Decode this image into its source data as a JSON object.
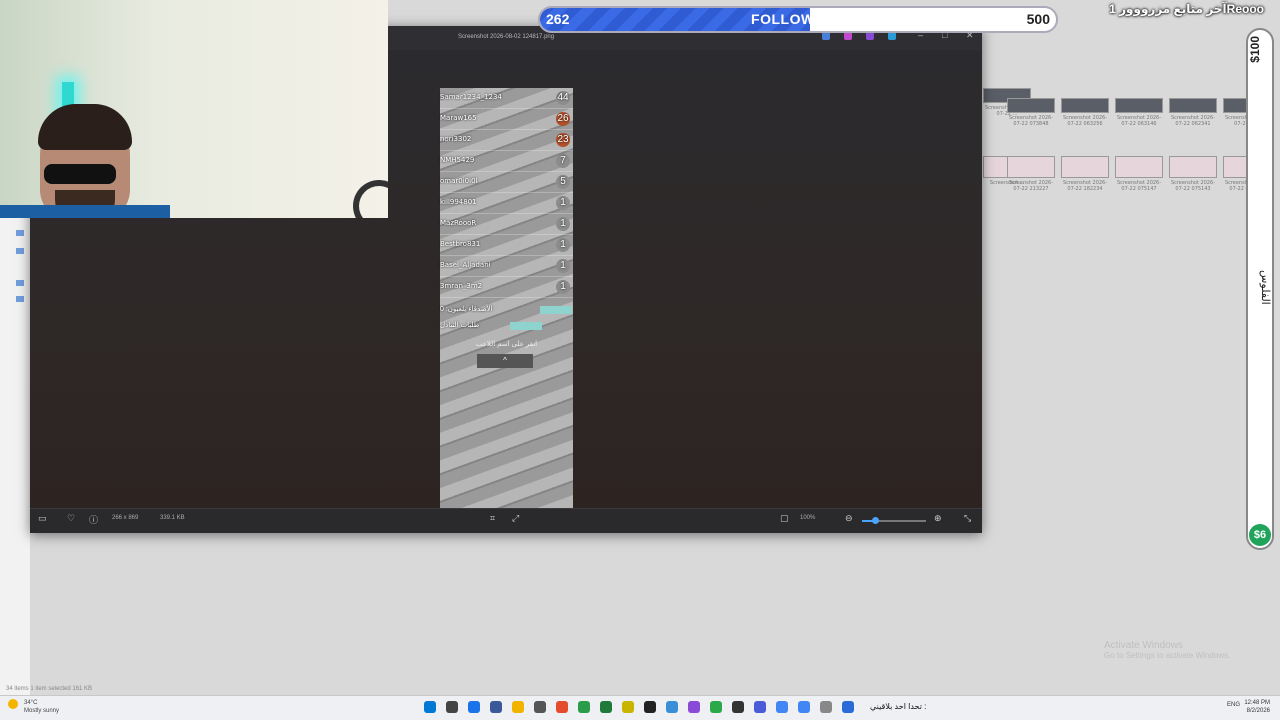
{
  "stream_overlay": {
    "followers": {
      "current": "262",
      "label": "FOLLOWERS",
      "goal": "500",
      "progress": 0.524
    },
    "latest_follower": "آخر متابع مزرووور 1Reooo",
    "donation": {
      "top": "$100",
      "mid": "الفلوس",
      "coin": "$6"
    }
  },
  "viewer": {
    "file_title": "Screenshot 2026-08-02 124817.png",
    "status": {
      "dimensions": "266 x 869",
      "size": "339.1 KB",
      "zoom": "100%",
      "zoom_level": 0.2
    }
  },
  "leaderboard": {
    "rows": [
      {
        "name": "Samar1234_1234",
        "count": "44",
        "color": "#8c8c8c"
      },
      {
        "name": "Maraw165",
        "count": "26",
        "color": "#b0502a"
      },
      {
        "name": "nori3302",
        "count": "23",
        "color": "#b0502a"
      },
      {
        "name": "NMH5429",
        "count": "7",
        "color": "#8c8c8c"
      },
      {
        "name": "omar0i0i0l",
        "count": "5",
        "color": "#8c8c8c"
      },
      {
        "name": "kill994801",
        "count": "1",
        "color": "#8c8c8c"
      },
      {
        "name": "MazRoooR",
        "count": "1",
        "color": "#8c8c8c"
      },
      {
        "name": "Bestbro831",
        "count": "1",
        "color": "#8c8c8c"
      },
      {
        "name": "Basel_Aljadani",
        "count": "1",
        "color": "#8c8c8c"
      },
      {
        "name": "3mran_3m2",
        "count": "1",
        "color": "#8c8c8c"
      }
    ],
    "extras": [
      "الأصدقاء يلعبون: 0",
      "طلبات التبادل"
    ],
    "note": "انقر على اسم اللاعب",
    "arrow": "^"
  },
  "files": [
    {
      "name": "Screenshot 2026-07-22 ...",
      "light": false
    },
    {
      "name": "Screenshot 2026-07-22 073848",
      "light": false
    },
    {
      "name": "Screenshot 2026-07-22 063256",
      "light": false
    },
    {
      "name": "Screenshot 2026-07-22 063146",
      "light": false
    },
    {
      "name": "Screenshot 2026-07-22 062341",
      "light": false
    },
    {
      "name": "Screenshot 2026-07-22 062",
      "light": false
    },
    {
      "name": "Screenshot ...",
      "light": true
    },
    {
      "name": "Screenshot 2026-07-22 213227",
      "light": true
    },
    {
      "name": "Screenshot 2026-07-22 182234",
      "light": true
    },
    {
      "name": "Screenshot 2026-07-22 075147",
      "light": true
    },
    {
      "name": "Screenshot 2026-07-22 075143",
      "light": true
    },
    {
      "name": "Screenshot 2026-07-22 075138",
      "light": true
    }
  ],
  "desktop": {
    "activate_title": "Activate Windows",
    "activate_sub": "Go to Settings to activate Windows.",
    "explorer_status": "34 items   1 item selected  161 KB"
  },
  "taskbar": {
    "weather_temp": "34°C",
    "weather_desc": "Mostly sunny",
    "marquee": "تحدا احد بلاقيني :",
    "tray": "ENG",
    "time": "12:48 PM",
    "date": "8/2/2026"
  }
}
